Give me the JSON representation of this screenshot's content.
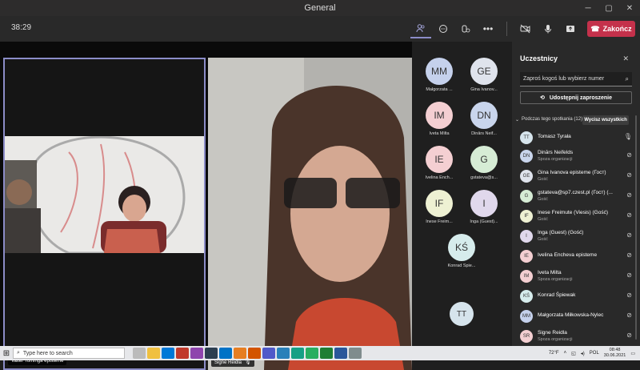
{
  "window": {
    "title": "General"
  },
  "meeting": {
    "timer": "38:29",
    "end_label": "Zakończ"
  },
  "tiles": [
    {
      "name": "Valter Tominga episteme"
    },
    {
      "name": "Signe Reidla"
    }
  ],
  "gallery": [
    {
      "initials": "MM",
      "name": "Małgorzata ...",
      "color": "#c5d1ec"
    },
    {
      "initials": "GE",
      "name": "Gina Ivanov...",
      "color": "#dfe3ec"
    },
    {
      "initials": "IM",
      "name": "Iveta Milta",
      "color": "#f4cfd2"
    },
    {
      "initials": "DN",
      "name": "Dinārs Neif...",
      "color": "#c9d5ec"
    },
    {
      "initials": "IE",
      "name": "Ivelina Ench...",
      "color": "#f4cfd2"
    },
    {
      "initials": "G",
      "name": "gstateva@s...",
      "color": "#d6ecd5"
    },
    {
      "initials": "IF",
      "name": "Inese Freim...",
      "color": "#eef1d3"
    },
    {
      "initials": "I",
      "name": "Inga (Guest)...",
      "color": "#e0d8ec"
    },
    {
      "initials": "KŚ",
      "name": "Konrad Śpie...",
      "color": "#d6ecec"
    },
    {
      "initials": "TT",
      "name": "",
      "color": "#d6e4ec"
    }
  ],
  "panel": {
    "title": "Uczestnicy",
    "invite_placeholder": "Zaproś kogoś lub wybierz numer",
    "share_label": "Udostępnij zaproszenie",
    "section_label": "Podczas tego spotkania (12)",
    "mute_all_label": "Wycisz wszystkich",
    "participants": [
      {
        "initials": "TT",
        "name": "Tomasz Tyrała",
        "sub": "",
        "color": "#d6e4ec"
      },
      {
        "initials": "DN",
        "name": "Dinārs Neifelds",
        "sub": "Spoza organizacji",
        "color": "#c9d5ec"
      },
      {
        "initials": "GE",
        "name": "Gina Ivanova episteme (Гост)",
        "sub": "Gość",
        "color": "#dfe3ec"
      },
      {
        "initials": "G",
        "name": "gstateva@sp7.czest.pl (Гост) (...",
        "sub": "Gość",
        "color": "#d6ecd5"
      },
      {
        "initials": "IF",
        "name": "Inese Freimute (Viesis) (Gość)",
        "sub": "Gość",
        "color": "#eef1d3"
      },
      {
        "initials": "I",
        "name": "Inga (Guest) (Gość)",
        "sub": "Gość",
        "color": "#e0d8ec"
      },
      {
        "initials": "IE",
        "name": "Ivelina Encheva episteme",
        "sub": "",
        "color": "#f4cfd2"
      },
      {
        "initials": "IM",
        "name": "Iveta Milta",
        "sub": "Spoza organizacji",
        "color": "#f4cfd2"
      },
      {
        "initials": "KŚ",
        "name": "Konrad Śpiewak",
        "sub": "",
        "color": "#d6ecec"
      },
      {
        "initials": "MM",
        "name": "Małgorzata Miłkowska-Nylec",
        "sub": "",
        "color": "#c5d1ec"
      },
      {
        "initials": "SR",
        "name": "Signe Reidla",
        "sub": "Spoza organizacji",
        "color": "#f4cfd2"
      }
    ]
  },
  "taskbar": {
    "search_placeholder": "Type here to search",
    "weather": "72°F",
    "lang": "POL",
    "time": "08:48",
    "date": "30.06.2021"
  }
}
